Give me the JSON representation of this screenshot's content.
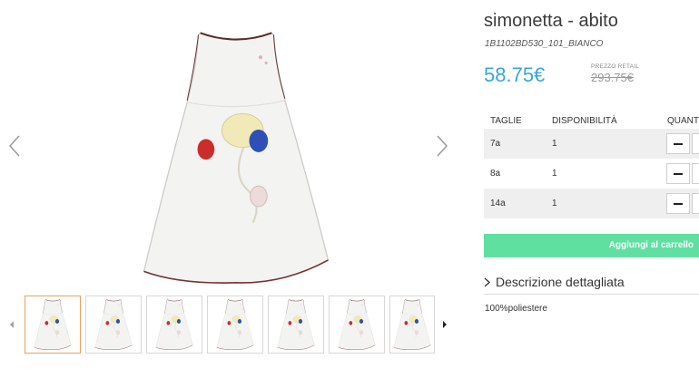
{
  "product": {
    "title": "simonetta - abito",
    "code": "1B1102BD530_101_BIANCO",
    "price": "58.75€",
    "retail_label": "PREZZO RETAIL",
    "retail_price": "293.75€"
  },
  "table": {
    "headers": {
      "size": "TAGLIE",
      "availability": "DISPONIBILITÀ",
      "quantity": "QUANTITÀ"
    },
    "rows": [
      {
        "size": "7a",
        "availability": "1"
      },
      {
        "size": "8a",
        "availability": "1"
      },
      {
        "size": "14a",
        "availability": "1"
      }
    ]
  },
  "cart_button": "Aggiungi al carrello",
  "description": {
    "label": "Descrizione dettagliata",
    "content": "100%poliestere"
  },
  "gallery": {
    "thumbnail_count": 7,
    "active_thumbnail": 1
  },
  "colors": {
    "price": "#3aa4dc",
    "cart_button": "#5fe0a1",
    "active_thumb_border": "#e8a15a"
  },
  "icons": {
    "prev": "chevron-left-icon",
    "next": "chevron-right-icon",
    "thumbs_prev": "caret-left-icon",
    "thumbs_next": "caret-right-icon",
    "description": "chevron-right-icon"
  }
}
